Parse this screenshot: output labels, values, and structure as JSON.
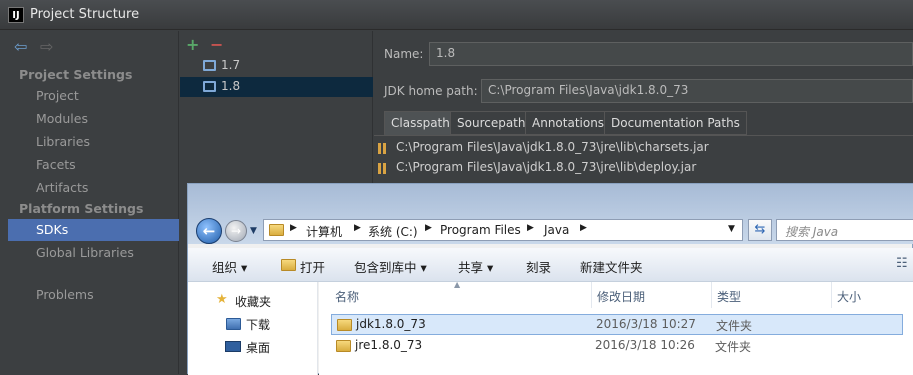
{
  "window": {
    "title": "Project Structure",
    "app_icon": "IJ"
  },
  "sidebar": {
    "project_settings_header": "Project Settings",
    "project_items": [
      "Project",
      "Modules",
      "Libraries",
      "Facets",
      "Artifacts"
    ],
    "platform_settings_header": "Platform Settings",
    "platform_items": [
      "SDKs",
      "Global Libraries"
    ],
    "problems": "Problems",
    "selected": "SDKs"
  },
  "sdk_list": {
    "add_symbol": "+",
    "remove_symbol": "−",
    "items": [
      "1.7",
      "1.8"
    ],
    "selected": "1.8"
  },
  "sdk_detail": {
    "name_label": "Name:",
    "name_value": "1.8",
    "home_label": "JDK home path:",
    "home_value": "C:\\Program Files\\Java\\jdk1.8.0_73",
    "tabs": [
      "Classpath",
      "Sourcepath",
      "Annotations",
      "Documentation Paths"
    ],
    "active_tab": "Classpath",
    "classpath": [
      "C:\\Program Files\\Java\\jdk1.8.0_73\\jre\\lib\\charsets.jar",
      "C:\\Program Files\\Java\\jdk1.8.0_73\\jre\\lib\\deploy.jar"
    ]
  },
  "explorer": {
    "breadcrumb": [
      "计算机",
      "系统 (C:)",
      "Program Files",
      "Java"
    ],
    "search_placeholder": "搜索 Java",
    "commands": [
      "组织 ▾",
      "打开",
      "包含到库中 ▾",
      "共享 ▾",
      "刻录",
      "新建文件夹"
    ],
    "nav": [
      "收藏夹",
      "下载",
      "桌面"
    ],
    "columns": [
      "名称",
      "修改日期",
      "类型",
      "大小"
    ],
    "files": [
      {
        "name": "jdk1.8.0_73",
        "date": "2016/3/18 10:27",
        "type": "文件夹"
      },
      {
        "name": "jre1.8.0_73",
        "date": "2016/3/18 10:26",
        "type": "文件夹"
      }
    ]
  },
  "colors": {
    "selection": "#4b6eaf",
    "accent": "#6d9ecf",
    "add": "#59a869",
    "remove": "#c75450"
  }
}
